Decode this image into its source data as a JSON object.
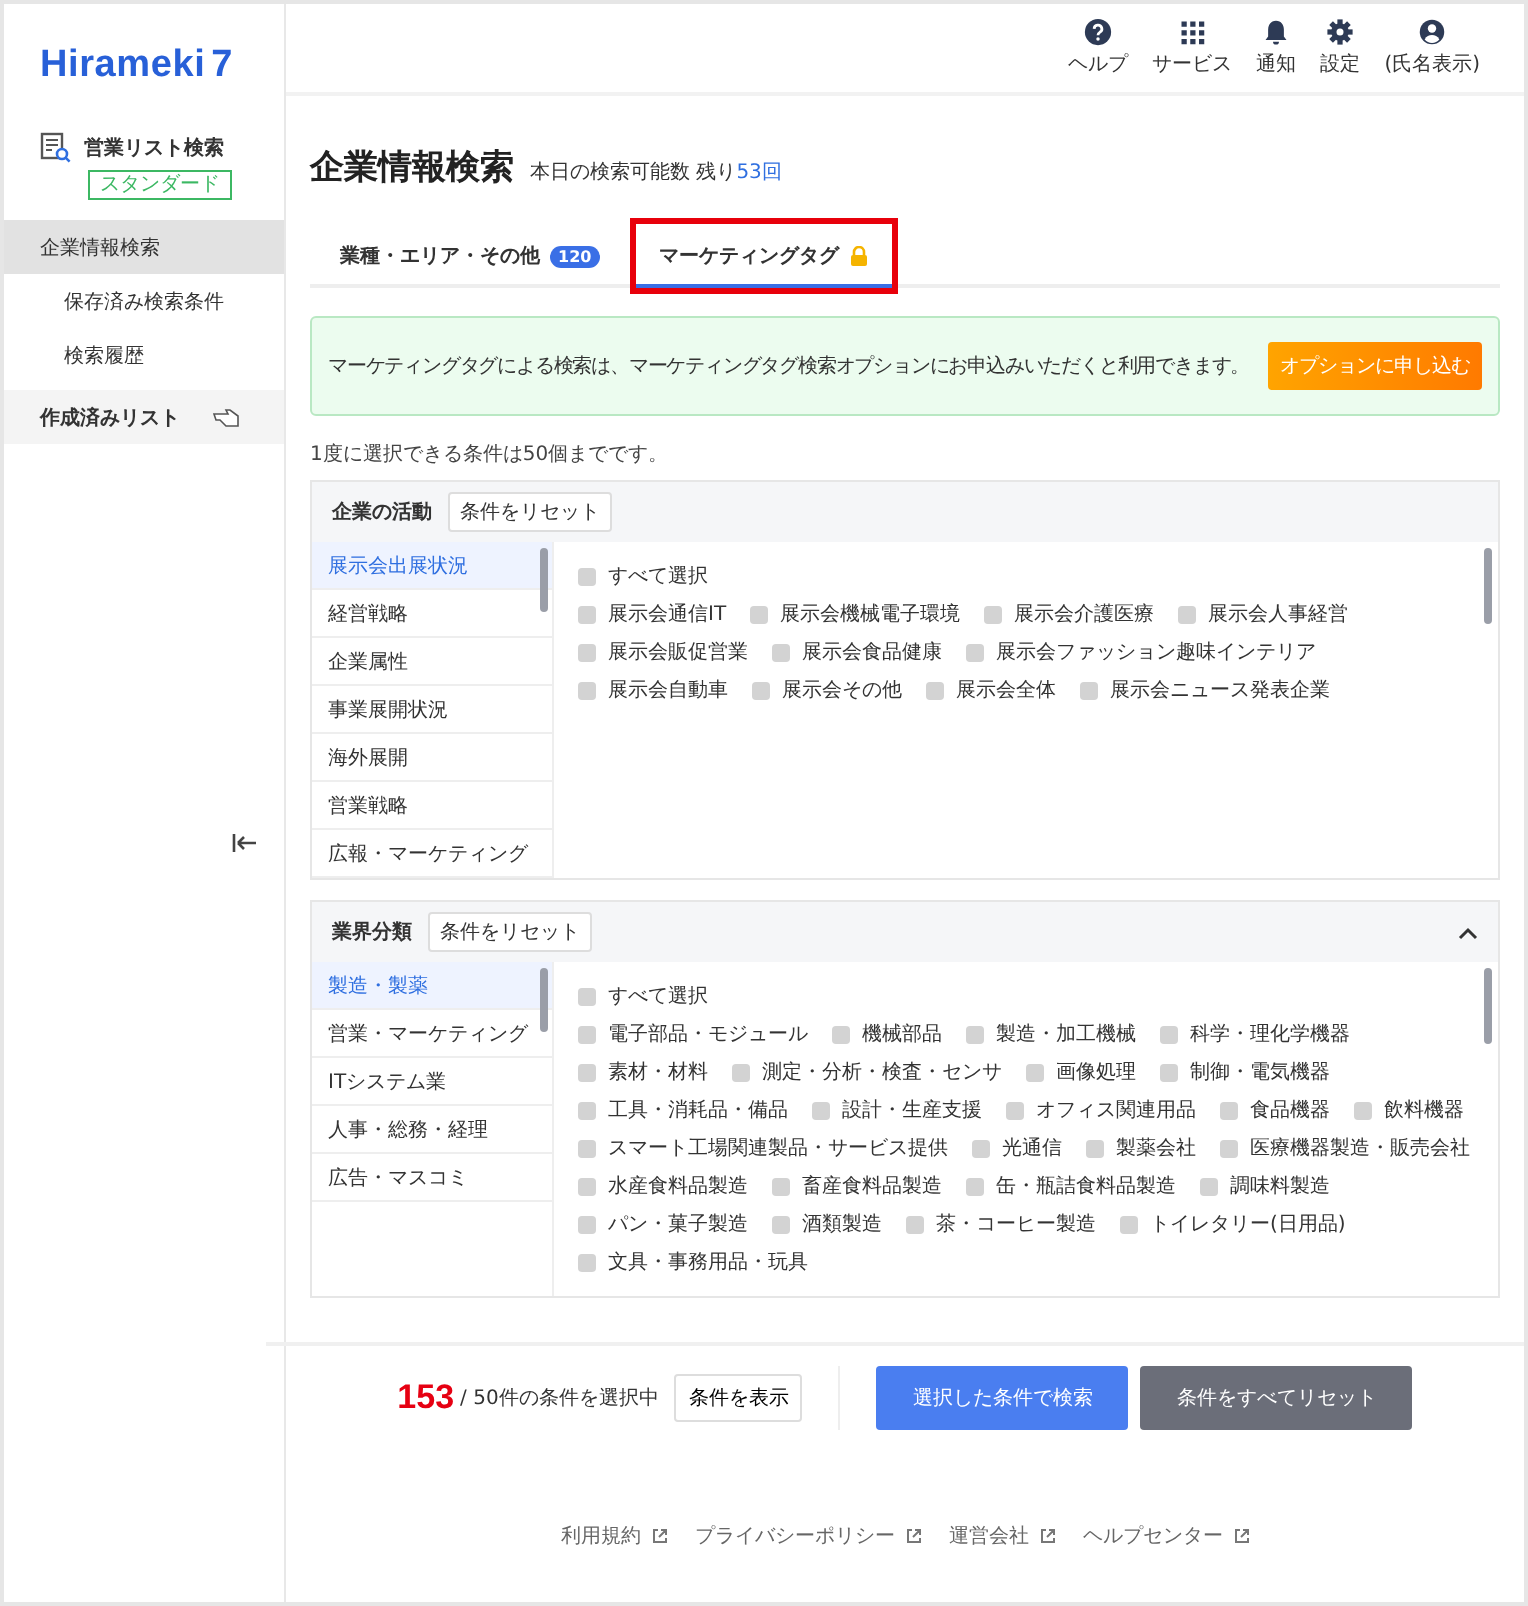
{
  "logo": {
    "text": "Hirameki",
    "number": "7"
  },
  "sidebar": {
    "section_title": "営業リスト検索",
    "plan_badge": "スタンダード",
    "items": [
      {
        "label": "企業情報検索",
        "kind": "main",
        "selected": true
      },
      {
        "label": "保存済み検索条件",
        "kind": "sub",
        "selected": false
      },
      {
        "label": "検索履歴",
        "kind": "sub",
        "selected": false
      },
      {
        "label": "作成済みリスト",
        "kind": "group",
        "selected": false
      }
    ]
  },
  "header": {
    "actions": [
      {
        "label": "ヘルプ",
        "kind": "help"
      },
      {
        "label": "サービス",
        "kind": "services"
      },
      {
        "label": "通知",
        "kind": "bell"
      },
      {
        "label": "設定",
        "kind": "settings"
      },
      {
        "label": "(氏名表示)",
        "kind": "user"
      }
    ]
  },
  "page": {
    "title": "企業情報検索",
    "quota_label": "本日の検索可能数",
    "quota_prefix": "残り",
    "quota_value": "53回"
  },
  "tabs": [
    {
      "label": "業種・エリア・その他",
      "badge": "120",
      "locked": false,
      "selected": false,
      "highlighted": false
    },
    {
      "label": "マーケティングタグ",
      "locked": true,
      "selected": true,
      "highlighted": true
    }
  ],
  "notice": {
    "text": "マーケティングタグによる検索は、マーケティングタグ検索オプションにお申込みいただくと利用できます。",
    "button": "オプションに申し込む"
  },
  "limit_note": "1度に選択できる条件は50個までです。",
  "panels": [
    {
      "title": "企業の活動",
      "reset_button": "条件をリセット",
      "categories": [
        {
          "label": "展示会出展状況",
          "selected": true
        },
        {
          "label": "経営戦略",
          "selected": false
        },
        {
          "label": "企業属性",
          "selected": false
        },
        {
          "label": "事業展開状況",
          "selected": false
        },
        {
          "label": "海外展開",
          "selected": false
        },
        {
          "label": "営業戦略",
          "selected": false
        },
        {
          "label": "広報・マーケティング",
          "selected": false
        }
      ],
      "select_all": {
        "label": "すべて選択",
        "checked": false
      },
      "options": [
        {
          "label": "展示会通信IT",
          "checked": false
        },
        {
          "label": "展示会機械電子環境",
          "checked": false
        },
        {
          "label": "展示会介護医療",
          "checked": false
        },
        {
          "label": "展示会人事経営",
          "checked": false
        },
        {
          "label": "展示会販促営業",
          "checked": false
        },
        {
          "label": "展示会食品健康",
          "checked": false
        },
        {
          "label": "展示会ファッション趣味インテリア",
          "checked": false
        },
        {
          "label": "展示会自動車",
          "checked": false
        },
        {
          "label": "展示会その他",
          "checked": false
        },
        {
          "label": "展示会全体",
          "checked": false
        },
        {
          "label": "展示会ニュース発表企業",
          "checked": false
        }
      ]
    },
    {
      "title": "業界分類",
      "reset_button": "条件をリセット",
      "expanded": true,
      "categories": [
        {
          "label": "製造・製薬",
          "selected": true
        },
        {
          "label": "営業・マーケティング",
          "selected": false
        },
        {
          "label": "ITシステム業",
          "selected": false
        },
        {
          "label": "人事・総務・経理",
          "selected": false
        },
        {
          "label": "広告・マスコミ",
          "selected": false
        }
      ],
      "select_all": {
        "label": "すべて選択",
        "checked": false
      },
      "options": [
        {
          "label": "電子部品・モジュール",
          "checked": false
        },
        {
          "label": "機械部品",
          "checked": false
        },
        {
          "label": "製造・加工機械",
          "checked": false
        },
        {
          "label": "科学・理化学機器",
          "checked": false
        },
        {
          "label": "素材・材料",
          "checked": false
        },
        {
          "label": "測定・分析・検査・センサ",
          "checked": false
        },
        {
          "label": "画像処理",
          "checked": false
        },
        {
          "label": "制御・電気機器",
          "checked": false
        },
        {
          "label": "工具・消耗品・備品",
          "checked": false
        },
        {
          "label": "設計・生産支援",
          "checked": false
        },
        {
          "label": "オフィス関連用品",
          "checked": false
        },
        {
          "label": "食品機器",
          "checked": false
        },
        {
          "label": "飲料機器",
          "checked": false
        },
        {
          "label": "スマート工場関連製品・サービス提供",
          "checked": false
        },
        {
          "label": "光通信",
          "checked": false
        },
        {
          "label": "製薬会社",
          "checked": false
        },
        {
          "label": "医療機器製造・販売会社",
          "checked": false
        },
        {
          "label": "水産食料品製造",
          "checked": false
        },
        {
          "label": "畜産食料品製造",
          "checked": false
        },
        {
          "label": "缶・瓶詰食料品製造",
          "checked": false
        },
        {
          "label": "調味料製造",
          "checked": false
        },
        {
          "label": "パン・菓子製造",
          "checked": false
        },
        {
          "label": "酒類製造",
          "checked": false
        },
        {
          "label": "茶・コーヒー製造",
          "checked": false
        },
        {
          "label": "トイレタリー(日用品)",
          "checked": false
        },
        {
          "label": "文具・事務用品・玩具",
          "checked": false
        }
      ]
    }
  ],
  "selection_bar": {
    "count": "153",
    "count_suffix": "/ 50件の条件を選択中",
    "show_button": "条件を表示",
    "search_button": "選択した条件で検索",
    "reset_all_button": "条件をすべてリセット"
  },
  "footer_links": [
    "利用規約",
    "プライバシーポリシー",
    "運営会社",
    "ヘルプセンター"
  ]
}
